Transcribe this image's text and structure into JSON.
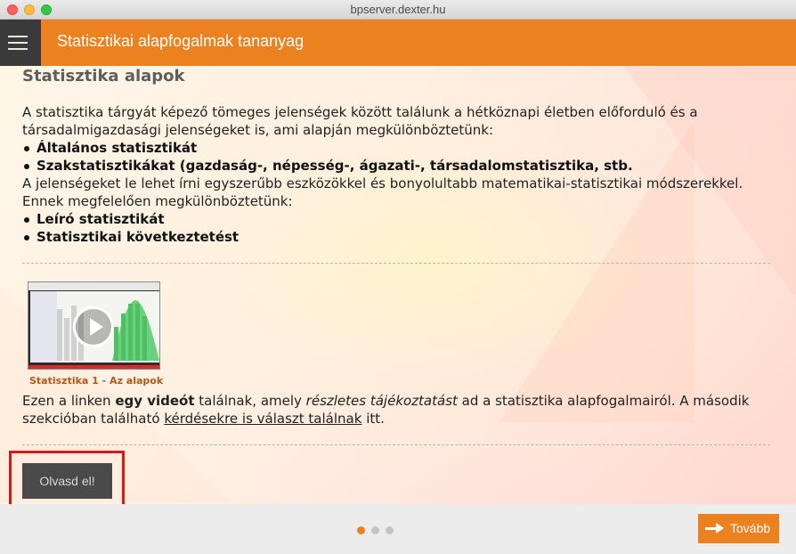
{
  "window": {
    "title": "bpserver.dexter.hu"
  },
  "appbar": {
    "title": "Statisztikai alapfogalmak tananyag",
    "menu_icon": "hamburger-icon",
    "accent": "#ec8120"
  },
  "main": {
    "section_title": "Statisztika alapok",
    "intro": "A statisztika tárgyát képező tömeges jelenségek között találunk a hétköznapi életben előforduló és a társadalmigazdasági jelenségeket is, ami alapján megkülönböztetünk:",
    "bullets1": [
      "Általános statisztikát",
      "Szakstatisztikákat (gazdaság-, népesség-, ágazati-, társadalomstatisztika, stb."
    ],
    "para2": "A jelenségeket le lehet írni egyszerűbb eszközökkel és bonyolultabb matematikai-statisztikai módszerekkel. Ennek megfelelően megkülönböztetünk:",
    "bullets2": [
      "Leíró statisztikát",
      "Statisztikai következtetést"
    ],
    "video": {
      "caption": "Statisztika 1 - Az alapok",
      "play_icon": "play-icon"
    },
    "link_text": {
      "p1": "Ezen a linken ",
      "b1": "egy videót",
      "p2": " találnak, amely ",
      "i1": "részletes tájékoztatást",
      "p3": " ad a statisztika alapfogalmairól. A második szekcióban található ",
      "u1": "kérdésekre is választ találnak",
      "p4": " itt."
    },
    "read_button": "Olvasd el!"
  },
  "footer": {
    "dots": [
      {
        "active": true,
        "color": "#ec8120"
      },
      {
        "active": false,
        "color": "#c4c4c4"
      },
      {
        "active": false,
        "color": "#c4c4c4"
      }
    ],
    "next_button": "Tovább",
    "next_icon": "arrow-right-icon"
  }
}
